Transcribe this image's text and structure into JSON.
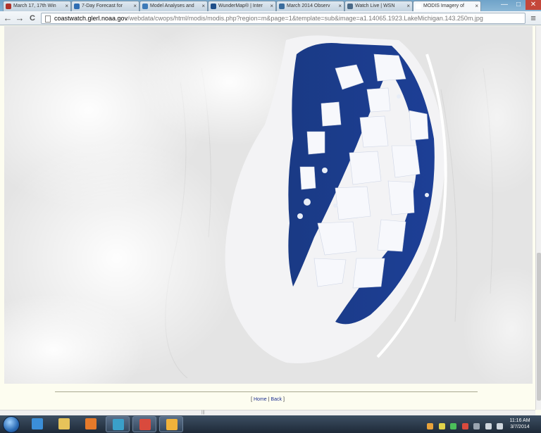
{
  "browser": {
    "tabs": [
      {
        "label": "March 17, 17th Win",
        "favicon_color": "#b0332a"
      },
      {
        "label": "7-Day Forecast for",
        "favicon_color": "#2e6db3"
      },
      {
        "label": "Model Analyses and",
        "favicon_color": "#3d7ab8"
      },
      {
        "label": "WunderMap® | Inter",
        "favicon_color": "#1f4f8a"
      },
      {
        "label": "March 2014 Observ",
        "favicon_color": "#3a6d9e"
      },
      {
        "label": "Watch Live | WSN",
        "favicon_color": "#4a6a88"
      },
      {
        "label": "MODIS Imagery of",
        "favicon_color": "#ffffff"
      }
    ],
    "active_tab": 6,
    "address": {
      "host": "coastwatch.glerl.noaa.gov",
      "path": "/webdata/cwops/html/modis/modis.php?region=m&page=1&template=sub&image=a1.14065.1923.LakeMichigan.143.250m.jpg"
    },
    "back_icon": "←",
    "forward_icon": "→",
    "reload_icon": "C",
    "menu_icon": "≡",
    "window_controls": {
      "minimize": "—",
      "maximize": "□",
      "close": "✕"
    }
  },
  "page": {
    "image_alt": "MODIS true-color image of Lake Michigan with ice cover",
    "footer": {
      "home": "Home",
      "back": "Back",
      "open": "[",
      "sep": "|",
      "close": "]"
    }
  },
  "colors": {
    "lake_dark": "#15306f",
    "lake_mid": "#2647a0",
    "ice": "#f5f7fb",
    "land": "#e3e3e3"
  },
  "taskbar": {
    "apps": [
      {
        "name": "internet-explorer-icon",
        "color": "#3b8ed8"
      },
      {
        "name": "file-explorer-icon",
        "color": "#e6c35a"
      },
      {
        "name": "media-player-icon",
        "color": "#e67a2a"
      },
      {
        "name": "lync-icon",
        "color": "#3aa0c9"
      },
      {
        "name": "chrome-icon",
        "color": "#d94a3d"
      },
      {
        "name": "outlook-icon",
        "color": "#f0b23a"
      }
    ],
    "time": "11:16 AM",
    "date": "3/7/2014"
  }
}
